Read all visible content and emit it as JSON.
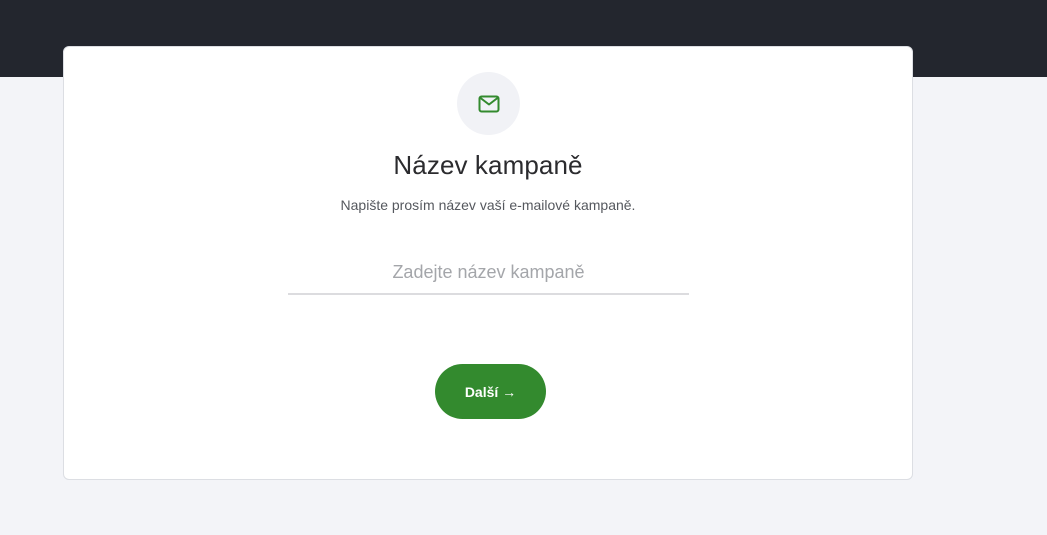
{
  "header": {
    "background": "#23262e"
  },
  "card": {
    "icon": "mail-icon",
    "title": "Název kampaně",
    "subtitle": "Napište prosím název vaší e-mailové kampaně.",
    "campaign_name": {
      "value": "",
      "placeholder": "Zadejte název kampaně"
    },
    "next_label": "Další →"
  },
  "colors": {
    "accent": "#338a2e",
    "page_background": "#f3f4f8",
    "card_background": "#ffffff"
  }
}
